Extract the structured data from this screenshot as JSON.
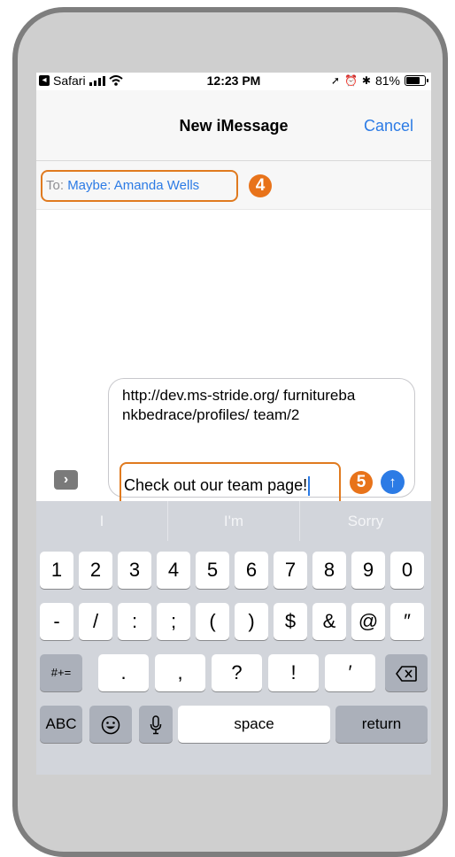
{
  "status_bar": {
    "back_app": "Safari",
    "time": "12:23 PM",
    "battery": "81%",
    "battery_level": 0.81
  },
  "nav": {
    "title": "New iMessage",
    "cancel_label": "Cancel"
  },
  "recipient": {
    "label": "To:",
    "value": "Maybe: Amanda Wells"
  },
  "steps": {
    "step4": "4",
    "step5": "5"
  },
  "composer": {
    "url_text": "http://dev.ms-stride.org/ furniturebankbedrace/profiles/ team/2",
    "message_text": "Check out our team page!",
    "expand_icon": "chevron-right-icon",
    "send_icon": "arrow-up-icon"
  },
  "predictions": [
    "I",
    "I'm",
    "Sorry"
  ],
  "keyboard": {
    "row1": [
      "1",
      "2",
      "3",
      "4",
      "5",
      "6",
      "7",
      "8",
      "9",
      "0"
    ],
    "row2": [
      "-",
      "/",
      ":",
      ";",
      "(",
      ")",
      "$",
      "&",
      "@",
      "″"
    ],
    "row3_left": "#+=",
    "row3": [
      ".",
      ",",
      "?",
      "!",
      "′"
    ],
    "row3_right_icon": "backspace-icon",
    "row4": {
      "abc": "ABC",
      "emoji_icon": "emoji-icon",
      "mic_icon": "microphone-icon",
      "space": "space",
      "return": "return"
    }
  },
  "colors": {
    "accent": "#2c7be5",
    "highlight": "#e07a1f",
    "keyboard_bg": "#d2d5db",
    "phone_frame": "#7e7e7e"
  }
}
